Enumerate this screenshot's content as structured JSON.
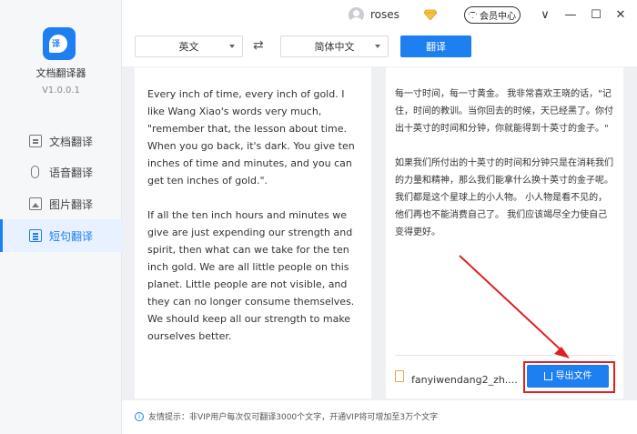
{
  "app": {
    "name": "文档翻译器",
    "version": "V1.0.0.1"
  },
  "sidebar": {
    "items": [
      {
        "label": "文档翻译",
        "icon": "document-icon"
      },
      {
        "label": "语音翻译",
        "icon": "microphone-icon"
      },
      {
        "label": "图片翻译",
        "icon": "image-icon"
      },
      {
        "label": "短句翻译",
        "icon": "short-text-icon",
        "active": true
      }
    ]
  },
  "titlebar": {
    "username": "roses",
    "member_center": "会员中心",
    "menu_glyph": "∨",
    "minimize_glyph": "—",
    "maximize_glyph": "☐",
    "close_glyph": "✕"
  },
  "toolbar": {
    "source_lang": "英文",
    "target_lang": "简体中文",
    "swap_glyph": "⇄",
    "translate_label": "翻译"
  },
  "source_text": {
    "p1": "Every inch of time, every inch of gold. I like Wang Xiao's words very much, \"remember that, the lesson about time. When you go back, it's dark. You give ten inches of time and minutes, and you can get ten inches of gold.\".",
    "p2": "If all the ten inch hours and minutes we give are just expending our strength and spirit, then what can we take for the ten inch gold. We are all little people on this planet. Little people are not visible, and they can no longer consume themselves. We should keep all our strength to make ourselves better."
  },
  "target_text": {
    "p1": "每一寸时间，每一寸黄金。 我非常喜欢王晓的话，\"记住，时间的教训。当你回去的时候，天已经黑了。你付出十英寸的时间和分钟，你就能得到十英寸的金子。\"",
    "p2": "如果我们所付出的十英寸的时间和分钟只是在消耗我们的力量和精神，那么我们能拿什么换十英寸的金子呢。我们都是这个星球上的小人物。 小人物是看不见的，他们再也不能消费自己了。 我们应该竭尽全力使自己变得更好。"
  },
  "output": {
    "file_name": "fanyiwendang2_zh....",
    "export_label": "导出文件"
  },
  "tip": "友情提示：非VIP用户每次仅可翻译3000个文字，开通VIP将可增加至3万个文字",
  "colors": {
    "accent": "#1e7ff0",
    "annotation": "#e02020"
  }
}
